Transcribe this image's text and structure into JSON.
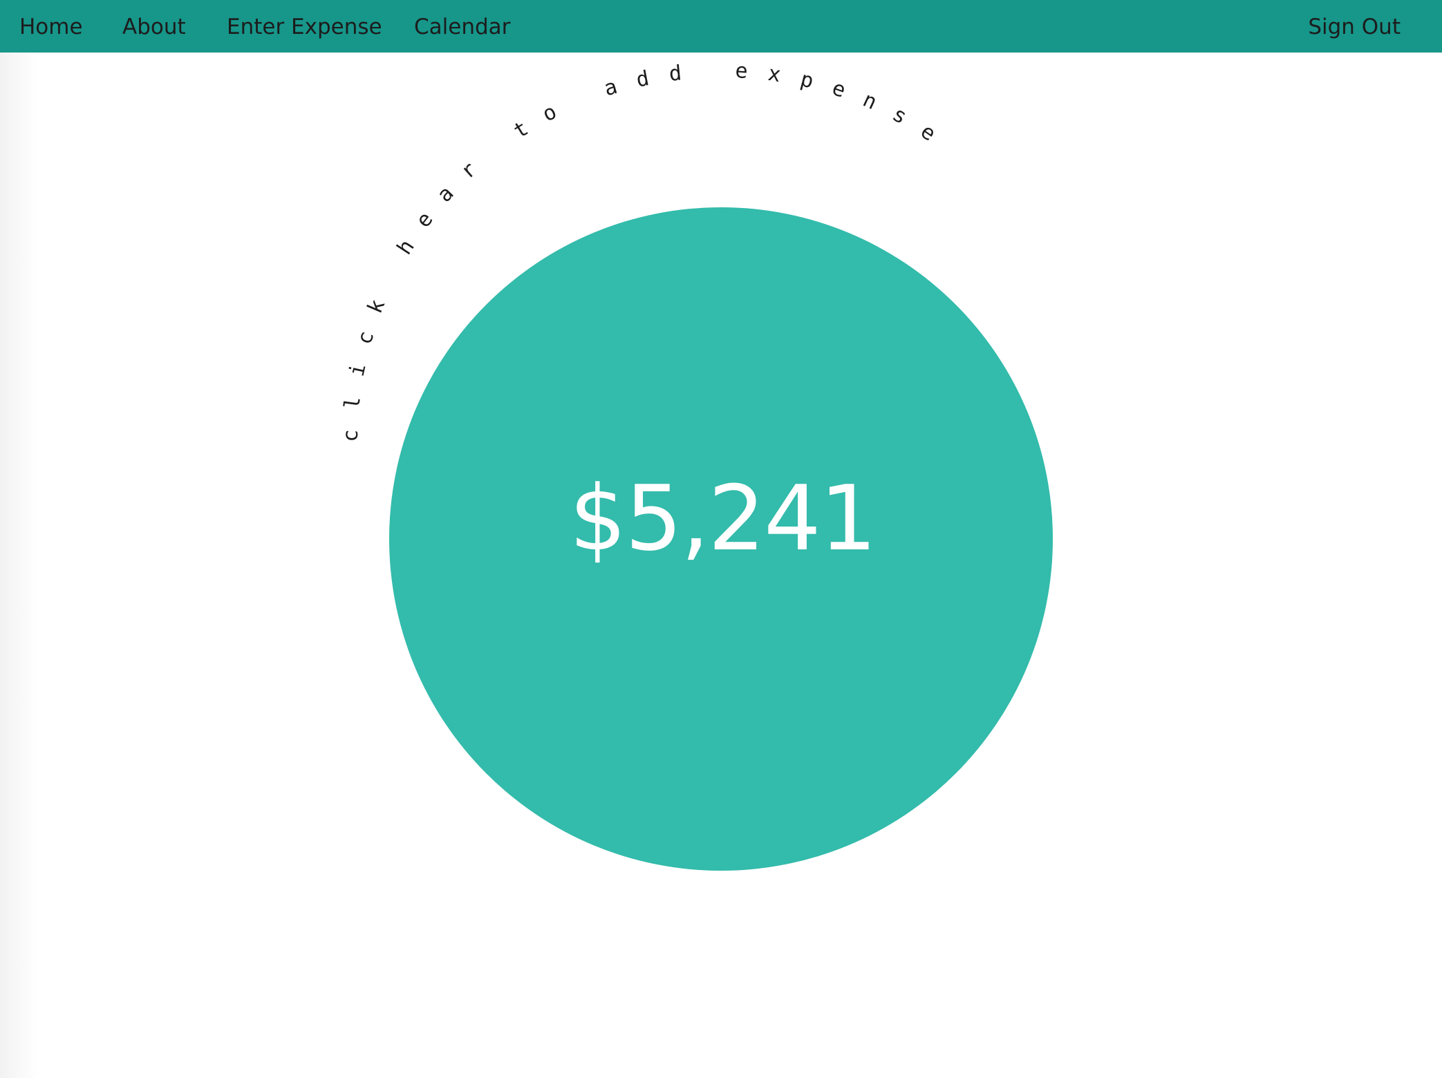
{
  "nav": {
    "home": "Home",
    "about": "About",
    "enter_expense": "Enter Expense",
    "calendar": "Calendar",
    "sign_out": "Sign Out"
  },
  "main": {
    "arc_prompt": "click hear to add expense",
    "total": "$5,241"
  },
  "colors": {
    "navbar": "#17968a",
    "circle": "#33bbab",
    "text_dark": "#1c1c1c",
    "amount_text": "#ffffff"
  }
}
